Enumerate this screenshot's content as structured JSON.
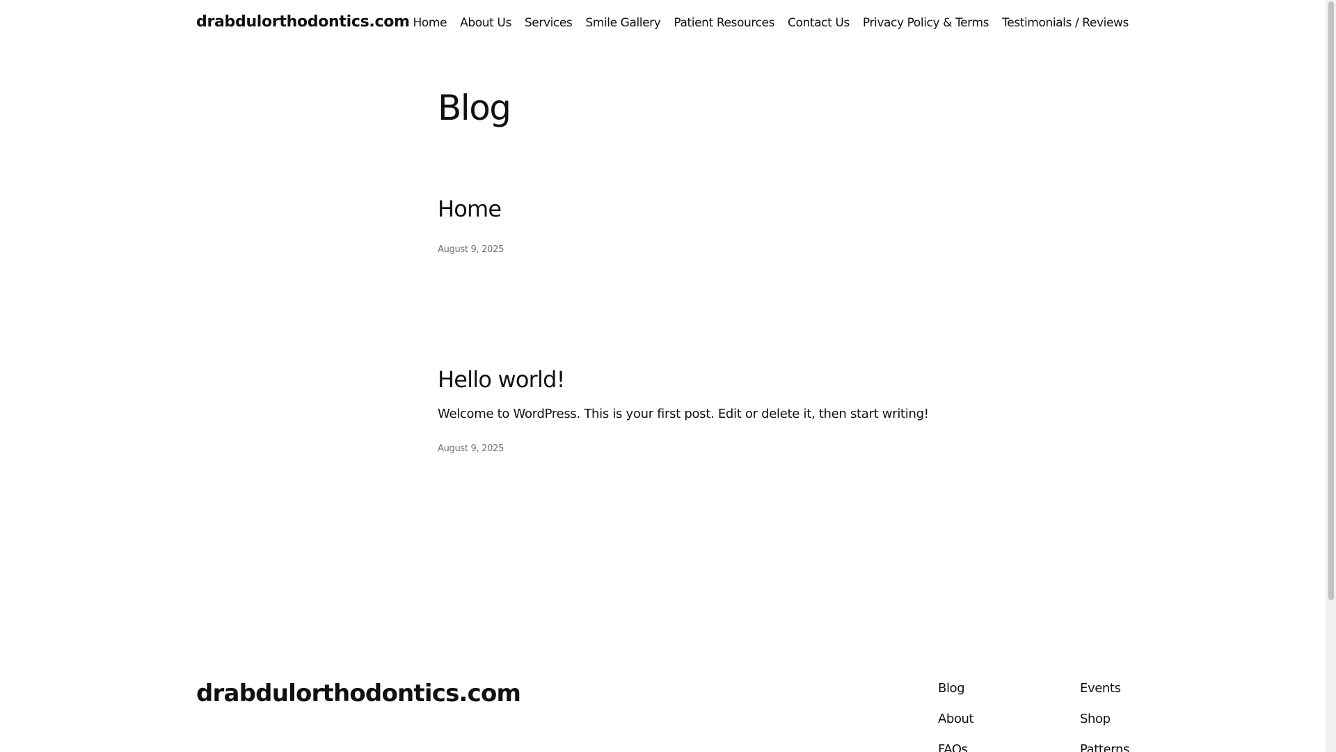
{
  "header": {
    "site_title": "drabdulorthodontics.com",
    "nav": [
      "Home",
      "About Us",
      "Services",
      "Smile Gallery",
      "Patient Resources",
      "Contact Us",
      "Privacy Policy & Terms",
      "Testimonials / Reviews"
    ]
  },
  "main": {
    "page_title": "Blog",
    "posts": [
      {
        "title": "Home",
        "excerpt": "",
        "date": "August 9, 2025"
      },
      {
        "title": "Hello world!",
        "excerpt": "Welcome to WordPress. This is your first post. Edit or delete it, then start writing!",
        "date": "August 9, 2025"
      }
    ]
  },
  "footer": {
    "site_title": "drabdulorthodontics.com",
    "columns": [
      [
        "Blog",
        "About",
        "FAQs"
      ],
      [
        "Events",
        "Shop",
        "Patterns"
      ]
    ]
  }
}
